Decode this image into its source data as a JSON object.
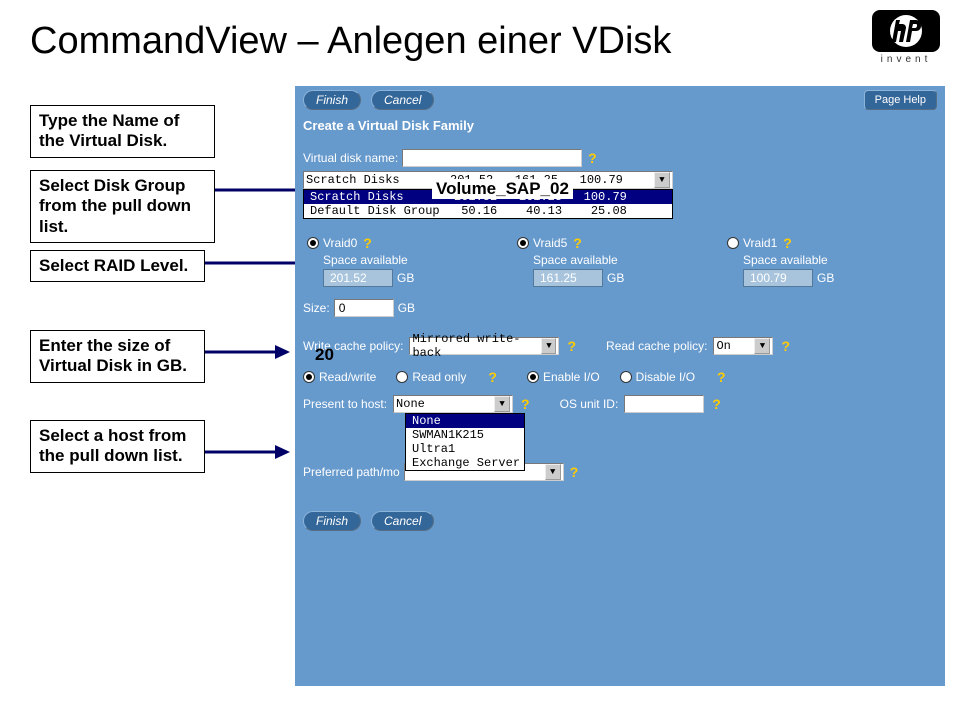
{
  "slide": {
    "title": "CommandView – Anlegen einer VDisk",
    "logo_caption": "invent"
  },
  "callouts": {
    "name": "Type the Name of the Virtual Disk.",
    "diskgroup": "Select Disk Group from the pull down list.",
    "raid": "Select RAID Level.",
    "size": "Enter the size of Virtual Disk in GB.",
    "host": "Select a host from the pull down list."
  },
  "overlays": {
    "vdisk_name_value": "Volume_SAP_02",
    "size_value": "20"
  },
  "panel": {
    "buttons": {
      "finish": "Finish",
      "cancel": "Cancel",
      "page_help": "Page Help"
    },
    "title": "Create a Virtual Disk Family",
    "labels": {
      "vdisk_name": "Virtual disk name:",
      "size": "Size:",
      "size_unit": "GB",
      "write_cache": "Write cache policy:",
      "read_cache": "Read cache policy:",
      "read_write": "Read/write",
      "read_only": "Read only",
      "enable_io": "Enable I/O",
      "disable_io": "Disable I/O",
      "present_to_host": "Present to host:",
      "os_unit_id": "OS unit ID:",
      "preferred_path": "Preferred path/mo"
    },
    "vdisk_name_placeholder": "",
    "disk_group_selected": "Scratch Disks       201.52   161.25   100.79",
    "disk_group_options": [
      "Scratch Disks       201.52   161.25   100.79",
      "Default Disk Group   50.16    40.13    25.08"
    ],
    "raid": [
      {
        "name": "Vraid0",
        "space_label": "Space available",
        "value": "201.52",
        "unit": "GB",
        "checked": true
      },
      {
        "name": "Vraid5",
        "space_label": "Space available",
        "value": "161.25",
        "unit": "GB",
        "checked": true
      },
      {
        "name": "Vraid1",
        "space_label": "Space available",
        "value": "100.79",
        "unit": "GB",
        "checked": false
      }
    ],
    "size_value": "0",
    "write_cache_value": "Mirrored write-back",
    "read_cache_value": "On",
    "host_selected": "None",
    "host_options": [
      "None",
      "SWMAN1K215",
      "Ultra1",
      "Exchange Server"
    ],
    "os_unit_id_value": ""
  }
}
